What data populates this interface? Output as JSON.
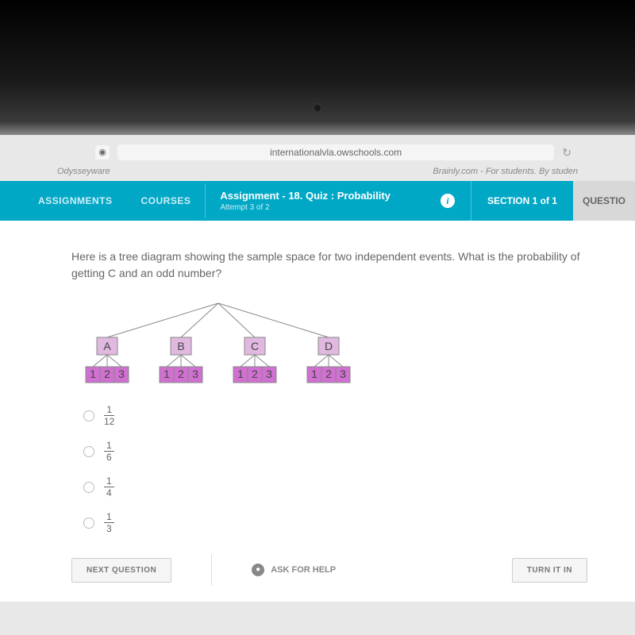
{
  "browser": {
    "url": "internationalvla.owschools.com",
    "tab_left": "Odysseyware",
    "tab_right": "Brainly.com - For students. By studen"
  },
  "header": {
    "nav": [
      {
        "label": "ASSIGNMENTS"
      },
      {
        "label": "COURSES"
      }
    ],
    "assignment_title": "Assignment - 18. Quiz : Probability",
    "attempt": "Attempt 3 of 2",
    "section": "SECTION 1 of 1",
    "question_tab": "QUESTIO"
  },
  "question": {
    "text": "Here is a tree diagram showing the sample space for two independent events. What is the probability of getting C and an odd number?"
  },
  "tree": {
    "letters": [
      "A",
      "B",
      "C",
      "D"
    ],
    "numbers": [
      "1",
      "2",
      "3"
    ]
  },
  "options": [
    {
      "num": "1",
      "den": "12"
    },
    {
      "num": "1",
      "den": "6"
    },
    {
      "num": "1",
      "den": "4"
    },
    {
      "num": "1",
      "den": "3"
    }
  ],
  "buttons": {
    "next": "NEXT QUESTION",
    "ask": "ASK FOR HELP",
    "turn_in": "TURN IT IN"
  }
}
